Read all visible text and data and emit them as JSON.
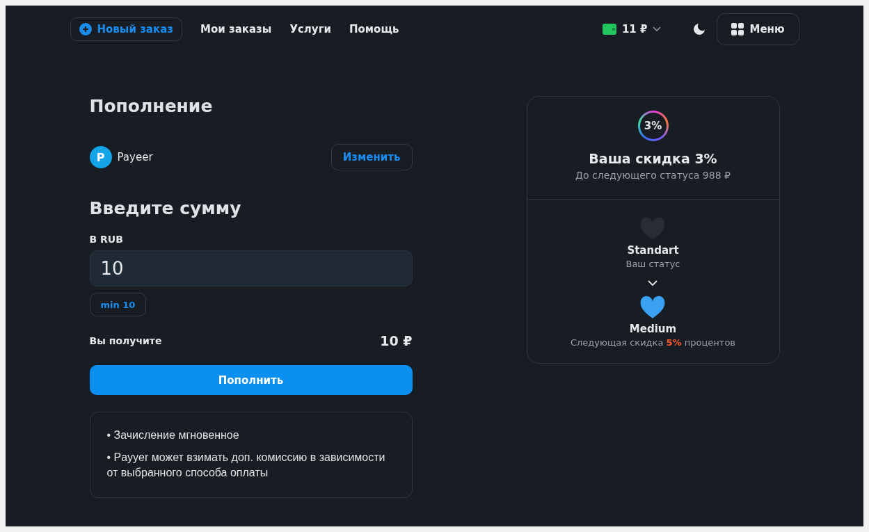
{
  "nav": {
    "new_order": "Новый заказ",
    "links": [
      "Мои заказы",
      "Услуги",
      "Помощь"
    ],
    "balance": "11 ₽",
    "menu": "Меню"
  },
  "topup": {
    "title": "Пополнение",
    "method": {
      "logo": "P",
      "name": "Payeer",
      "change": "Изменить"
    },
    "amount_title": "Введите сумму",
    "field_label": "В RUB",
    "value": "10",
    "min_chip": "min 10",
    "receive_label": "Вы получите",
    "receive_value": "10 ₽",
    "submit": "Пополнить",
    "notes": [
      "• Зачисление мгновенное",
      "• Рayyer может взимать доп. комиссию в зависимости от выбранного способа оплаты"
    ]
  },
  "discount": {
    "badge": "3%",
    "title": "Ваша скидка 3%",
    "subtitle": "До следующего статуса 988 ₽",
    "tiers": [
      {
        "name": "Standart",
        "caption": "Ваш статус",
        "color": "#2a2c33"
      },
      {
        "name": "Medium",
        "caption": "Следующая скидка **5%** процентов",
        "color": "#3aa0f0"
      }
    ]
  }
}
